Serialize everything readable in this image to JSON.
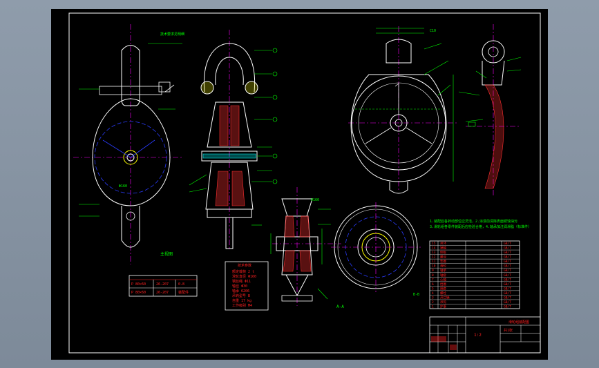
{
  "drawing": {
    "sheet_background": "#000000",
    "viewport_background": "#8a97a7",
    "colors": {
      "outline": "#ffffff",
      "centerline": "#ff00ff",
      "hidden": "#2a3cff",
      "dimension": "#00ff00",
      "hatch": "#ff3030",
      "table_text": "#ff2020",
      "frame": "#ffffff",
      "highlight": "#ffff00",
      "cyan": "#00ffff"
    },
    "icons": [
      "pulley-block-front-view",
      "pulley-block-section-view",
      "pulley-side-view",
      "wheel-section",
      "wheel-face-view"
    ]
  },
  "notes": {
    "tech_requirements_line1": "1.装配后各转动部位应灵活，2.涂漆前清除表面锈蚀油污",
    "tech_requirements_line2": "3.滑轮组各零件装配后应检验合格，4.轴承加注润滑脂（标准件）"
  },
  "specs": {
    "title": "技术参数",
    "rows": [
      "额定载荷 2 t",
      "滑轮直径 Φ160",
      "钢丝绳 Φ11",
      "轴径 Φ30",
      "轴承 6206",
      "吊钩型号 B",
      "自重 17 kg",
      "工作级别 M4"
    ]
  },
  "small_table": {
    "rows": [
      [
        "P 80×60",
        "26-207",
        "0.8"
      ],
      [
        "P 80×60",
        "26-207",
        "装配件"
      ]
    ]
  },
  "parts": {
    "rows": [
      "吊环",
      "销轴",
      "侧板",
      "螺母",
      "垫圈",
      "滑轮",
      "轴承",
      "轴套",
      "心轴",
      "挡圈",
      "隔套",
      "螺栓",
      "开口销",
      "吊钩",
      "护罩"
    ],
    "codes": [
      "GB/T",
      "GB/T",
      "GB/T",
      "GB/T",
      "GB/T",
      "GB/T",
      "GB/T",
      "GB/T",
      "GB/T",
      "GB/T",
      "GB/T",
      "GB/T",
      "GB/T",
      "GB/T",
      "GB/T"
    ]
  },
  "title_block": {
    "name": "滑轮组装配图",
    "scale": "1:2",
    "sheet": "共1张"
  },
  "view_labels": {
    "front": "主视图",
    "section": "A-A",
    "wheel": "B-B"
  }
}
